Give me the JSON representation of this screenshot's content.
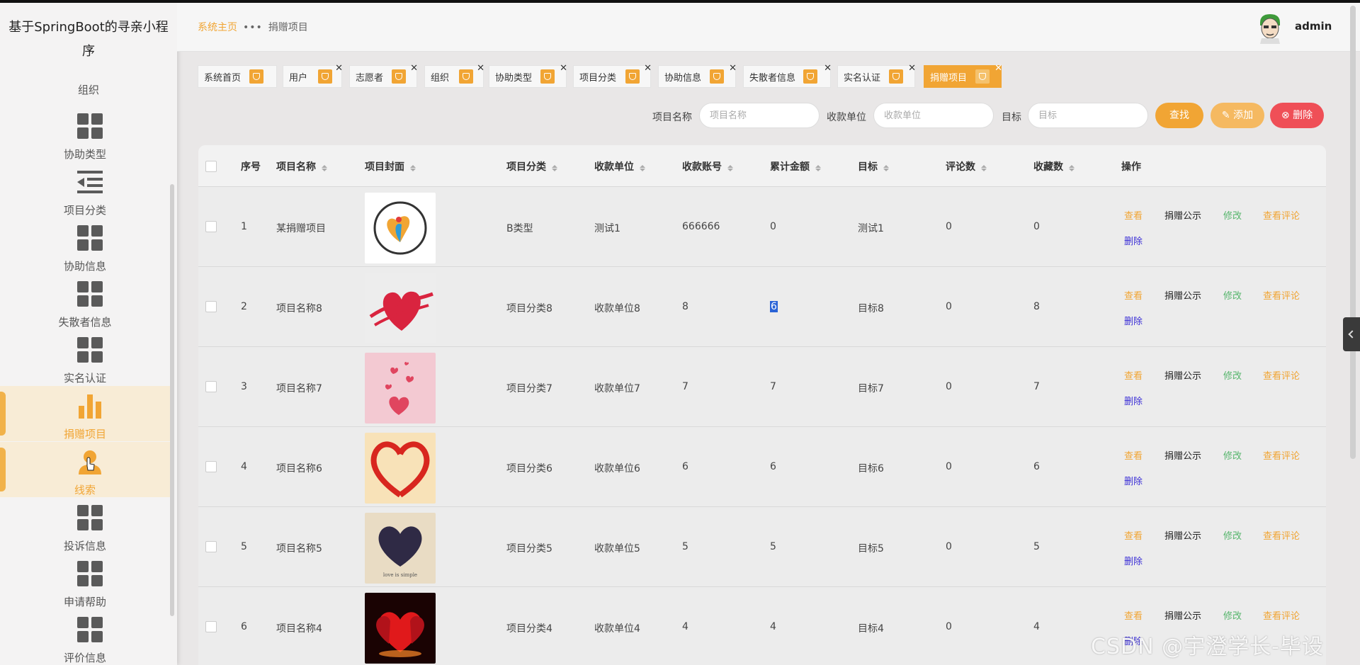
{
  "brand": "基于SpringBoot的寻亲小程序",
  "sidebar": {
    "partial_label": "组织",
    "items": [
      {
        "label": "协助类型",
        "icon": "grid-icon"
      },
      {
        "label": "项目分类",
        "icon": "list-indent-icon"
      },
      {
        "label": "协助信息",
        "icon": "grid-icon"
      },
      {
        "label": "失散者信息",
        "icon": "grid-icon"
      },
      {
        "label": "实名认证",
        "icon": "grid-icon"
      },
      {
        "label": "捐赠项目",
        "icon": "bar-chart-icon",
        "active": true
      },
      {
        "label": "线索",
        "icon": "person-icon",
        "active": true
      },
      {
        "label": "投诉信息",
        "icon": "grid-icon"
      },
      {
        "label": "申请帮助",
        "icon": "grid-icon"
      },
      {
        "label": "评价信息",
        "icon": "grid-icon"
      }
    ]
  },
  "header": {
    "home": "系统主页",
    "dots": "•••",
    "current": "捐赠项目",
    "user": "admin"
  },
  "tags": [
    "系统首页",
    "用户",
    "志愿者",
    "组织",
    "协助类型",
    "项目分类",
    "协助信息",
    "失散者信息",
    "实名认证",
    "捐赠项目"
  ],
  "search": {
    "name_label": "项目名称",
    "name_placeholder": "项目名称",
    "unit_label": "收款单位",
    "unit_placeholder": "收款单位",
    "goal_label": "目标",
    "goal_placeholder": "目标",
    "find": "查找",
    "add": "添加",
    "delete": "删除"
  },
  "table": {
    "headers": [
      "序号",
      "项目名称",
      "项目封面",
      "项目分类",
      "收款单位",
      "收款账号",
      "累计金额",
      "目标",
      "评论数",
      "收藏数",
      "操作"
    ],
    "ops": {
      "view": "查看",
      "publicity": "捐赠公示",
      "edit": "修改",
      "reviews": "查看评论",
      "delete": "删除"
    },
    "rows": [
      [
        "1",
        "某捐赠项目",
        "",
        "B类型",
        "测试1",
        "666666",
        "0",
        "测试1",
        "0",
        "0"
      ],
      [
        "2",
        "项目名称8",
        "",
        "项目分类8",
        "收款单位8",
        "8",
        "6",
        "目标8",
        "0",
        "8"
      ],
      [
        "3",
        "项目名称7",
        "",
        "项目分类7",
        "收款单位7",
        "7",
        "7",
        "目标7",
        "0",
        "7"
      ],
      [
        "4",
        "项目名称6",
        "",
        "项目分类6",
        "收款单位6",
        "6",
        "6",
        "目标6",
        "0",
        "6"
      ],
      [
        "5",
        "项目名称5",
        "",
        "项目分类5",
        "收款单位5",
        "5",
        "5",
        "目标5",
        "0",
        "5"
      ],
      [
        "6",
        "项目名称4",
        "",
        "项目分类4",
        "收款单位4",
        "4",
        "4",
        "目标4",
        "0",
        "4"
      ]
    ]
  },
  "watermark": "CSDN @宇澄学长-毕设",
  "colors": {
    "accent": "#f1a534",
    "danger": "#ef4f57",
    "edit": "#55b56b",
    "delete_link": "#3b2fd6"
  }
}
